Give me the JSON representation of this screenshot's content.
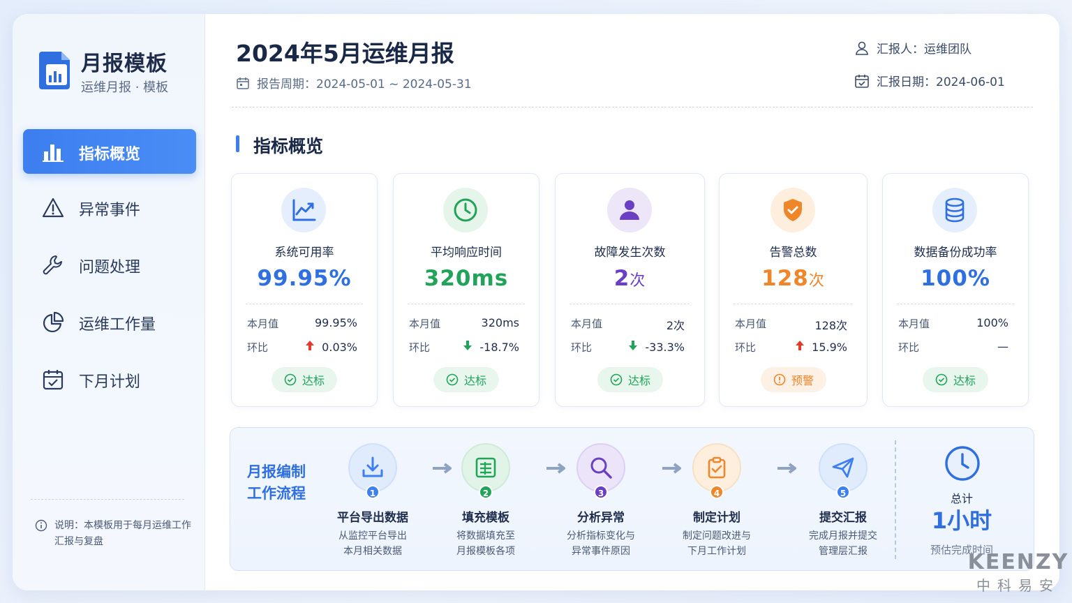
{
  "app": {
    "title": "月报模板",
    "subtitle": "运维月报 · 模板"
  },
  "nav": [
    {
      "label": "指标概览",
      "icon": "bar-chart-icon",
      "active": true
    },
    {
      "label": "异常事件",
      "icon": "warning-icon",
      "active": false
    },
    {
      "label": "问题处理",
      "icon": "wrench-icon",
      "active": false
    },
    {
      "label": "运维工作量",
      "icon": "pie-chart-icon",
      "active": false
    },
    {
      "label": "下月计划",
      "icon": "calendar-check-icon",
      "active": false
    }
  ],
  "note": {
    "text": "说明：本模板用于每月运维工作汇报与复盘"
  },
  "header": {
    "title": "2024年5月运维月报",
    "period": "报告周期：2024-05-01 ~ 2024-05-31",
    "reporter": "汇报人：运维团队",
    "report_date": "汇报日期：2024-06-01"
  },
  "section": {
    "title": "指标概览"
  },
  "cards": [
    {
      "title": "系统可用率",
      "value": "99.95%",
      "unit": "",
      "current_label": "本月值",
      "current": "99.95%",
      "mom_label": "环比",
      "mom": "0.03%",
      "trend": "up",
      "status": "达标",
      "status_type": "ok",
      "color": "#2f6fe0",
      "icon": "trend-line-icon"
    },
    {
      "title": "平均响应时间",
      "value": "320ms",
      "unit": "",
      "current_label": "本月值",
      "current": "320ms",
      "mom_label": "环比",
      "mom": "-18.7%",
      "trend": "down",
      "status": "达标",
      "status_type": "ok",
      "color": "#22a35a",
      "icon": "clock-icon"
    },
    {
      "title": "故障发生次数",
      "value": "2",
      "unit": "次",
      "current_label": "本月值",
      "current": "2次",
      "mom_label": "环比",
      "mom": "-33.3%",
      "trend": "down",
      "status": "达标",
      "status_type": "ok",
      "color": "#6b3fc4",
      "icon": "user-icon"
    },
    {
      "title": "告警总数",
      "value": "128",
      "unit": "次",
      "current_label": "本月值",
      "current": "128次",
      "mom_label": "环比",
      "mom": "15.9%",
      "trend": "up",
      "status": "预警",
      "status_type": "warn",
      "color": "#f0862a",
      "icon": "shield-check-icon"
    },
    {
      "title": "数据备份成功率",
      "value": "100%",
      "unit": "",
      "current_label": "本月值",
      "current": "100%",
      "mom_label": "环比",
      "mom": "—",
      "trend": "none",
      "status": "达标",
      "status_type": "ok",
      "color": "#2f6fe0",
      "icon": "database-icon"
    }
  ],
  "workflow": {
    "title_line1": "月报编制",
    "title_line2": "工作流程",
    "steps": [
      {
        "num": "1",
        "title": "平台导出数据",
        "desc1": "从监控平台导出",
        "desc2": "本月相关数据",
        "icon": "download-icon",
        "color": "#3d7ef0"
      },
      {
        "num": "2",
        "title": "填充模板",
        "desc1": "将数据填充至",
        "desc2": "月报模板各项",
        "icon": "table-icon",
        "color": "#22a35a"
      },
      {
        "num": "3",
        "title": "分析异常",
        "desc1": "分析指标变化与",
        "desc2": "异常事件原因",
        "icon": "search-icon",
        "color": "#6b3fc4"
      },
      {
        "num": "4",
        "title": "制定计划",
        "desc1": "制定问题改进与",
        "desc2": "下月工作计划",
        "icon": "clipboard-check-icon",
        "color": "#f0862a"
      },
      {
        "num": "5",
        "title": "提交汇报",
        "desc1": "完成月报并提交",
        "desc2": "管理层汇报",
        "icon": "send-icon",
        "color": "#3d7ef0"
      }
    ],
    "total_label": "总计",
    "total_value": "1小时",
    "total_sub": "预估完成时间"
  },
  "watermark": {
    "brand": "KEENZY",
    "cn": "中科易安"
  }
}
